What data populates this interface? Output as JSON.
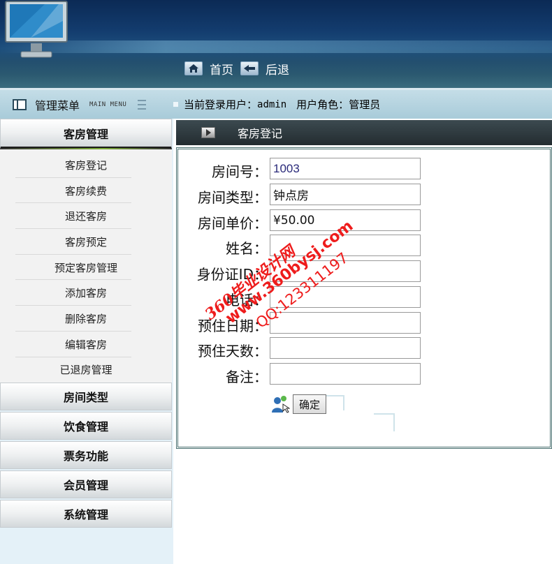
{
  "header": {
    "nav": [
      {
        "label": "首页",
        "icon": "home-icon"
      },
      {
        "label": "后退",
        "icon": "back-arrow-icon"
      }
    ]
  },
  "menu_bar": {
    "title": "管理菜单",
    "subtitle": "MAIN MENU",
    "current_user_label": "当前登录用户：",
    "current_user": "admin",
    "role_label": "用户角色：",
    "role": "管理员"
  },
  "sidebar": {
    "active_section": "客房管理",
    "items": [
      "客房登记",
      "客房续费",
      "退还客房",
      "客房预定",
      "预定客房管理",
      "添加客房",
      "删除客房",
      "编辑客房",
      "已退房管理"
    ],
    "sections": [
      "房间类型",
      "饮食管理",
      "票务功能",
      "会员管理",
      "系统管理"
    ]
  },
  "panel": {
    "title": "客房登记"
  },
  "form": {
    "room_no": {
      "label": "房间号：",
      "value": "1003"
    },
    "room_type": {
      "label": "房间类型：",
      "value": "钟点房"
    },
    "room_price": {
      "label": "房间单价：",
      "value": "¥50.00"
    },
    "name": {
      "label": "姓名：",
      "value": ""
    },
    "id_card": {
      "label": "身份证ID：",
      "value": ""
    },
    "phone": {
      "label": "电话：",
      "value": ""
    },
    "reserve_date": {
      "label": "预住日期：",
      "value": ""
    },
    "reserve_days": {
      "label": "预住天数：",
      "value": ""
    },
    "remark": {
      "label": "备注：",
      "value": ""
    },
    "submit_label": "确定"
  },
  "watermark": {
    "line1": "360毕业设计网",
    "line2": "www.360bysj.com",
    "line3": "QQ:123311197"
  },
  "colors": {
    "banner": "#133c6e",
    "menu_bar": "#b6d4e0",
    "panel_head": "#2c373c",
    "watermark": "#ee1c1c"
  }
}
